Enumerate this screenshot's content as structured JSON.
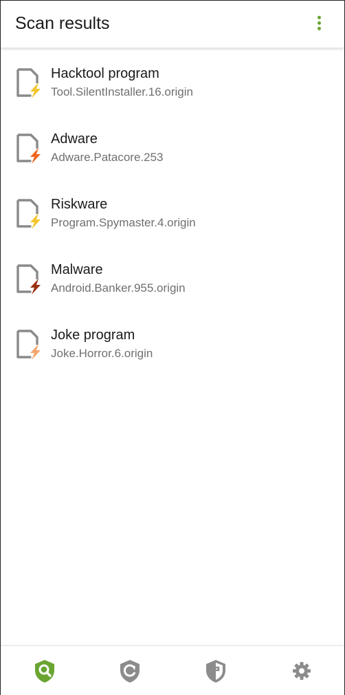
{
  "header": {
    "title": "Scan results",
    "menu_icon": "more-vert-icon",
    "accent_color": "#6aa532"
  },
  "results": [
    {
      "category": "Hacktool program",
      "threat": "Tool.SilentInstaller.16.origin",
      "bolt_color": "#f2c530"
    },
    {
      "category": "Adware",
      "threat": "Adware.Patacore.253",
      "bolt_color": "#f0641e"
    },
    {
      "category": "Riskware",
      "threat": "Program.Spymaster.4.origin",
      "bolt_color": "#f2c530"
    },
    {
      "category": "Malware",
      "threat": "Android.Banker.955.origin",
      "bolt_color": "#9a3012"
    },
    {
      "category": "Joke program",
      "threat": "Joke.Horror.6.origin",
      "bolt_color": "#f5a56e"
    }
  ],
  "bottom_nav": [
    {
      "icon": "shield-search-icon",
      "active": true,
      "color": "#6aa532"
    },
    {
      "icon": "shield-refresh-icon",
      "active": false,
      "color": "#8c8c8c"
    },
    {
      "icon": "shield-firewall-icon",
      "active": false,
      "color": "#8c8c8c"
    },
    {
      "icon": "gear-icon",
      "active": false,
      "color": "#8c8c8c"
    }
  ]
}
